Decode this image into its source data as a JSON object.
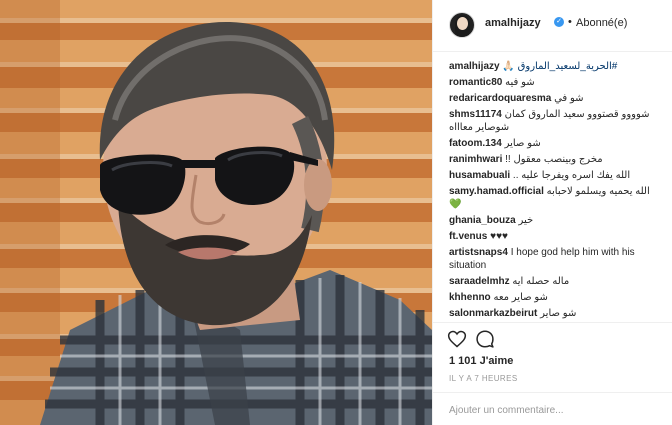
{
  "header": {
    "username": "amalhijazy",
    "verified_icon": "verified-badge-icon",
    "separator": "•",
    "follow_status": "Abonné(e)"
  },
  "caption": {
    "username": "amalhijazy",
    "text": "#الحرية_لسعيد_الماروق 🙏🏻"
  },
  "comments": [
    {
      "user": "romantic80",
      "text": "شو فيه"
    },
    {
      "user": "redaricardoquaresma",
      "text": "شو في"
    },
    {
      "user": "shms11174",
      "text": "شوووو قصتووو سعيد الماروق كمان شوصاير معاااه"
    },
    {
      "user": "fatoom.134",
      "text": "شو صاير"
    },
    {
      "user": "ranimhwari",
      "text": "مخرج وبينصب معقول !!"
    },
    {
      "user": "husamabuali",
      "text": "الله يفك اسره ويفرجا عليه .."
    },
    {
      "user": "samy.hamad.official",
      "text": "الله يحميه ويسلمو لاحبابه 💚"
    },
    {
      "user": "ghania_bouza",
      "text": "خير"
    },
    {
      "user": "ft.venus",
      "text": "♥♥♥"
    },
    {
      "user": "artistsnaps4",
      "text": "I hope god help him with his situation"
    },
    {
      "user": "saraadelmhz",
      "text": "ماله حصله ايه"
    },
    {
      "user": "khhenno",
      "text": "شو صاير معه"
    },
    {
      "user": "salonmarkazbeirut",
      "text": "شو صاير"
    }
  ],
  "actions": {
    "like_icon": "heart-icon",
    "comment_icon": "comment-icon"
  },
  "likes": "1 101 J'aime",
  "timestamp": "IL Y A 7 HEURES",
  "add_comment": {
    "placeholder": "Ajouter un commentaire..."
  },
  "colors": {
    "verified": "#3897f0",
    "divider": "#efefef",
    "muted": "#999999",
    "text": "#262626"
  }
}
